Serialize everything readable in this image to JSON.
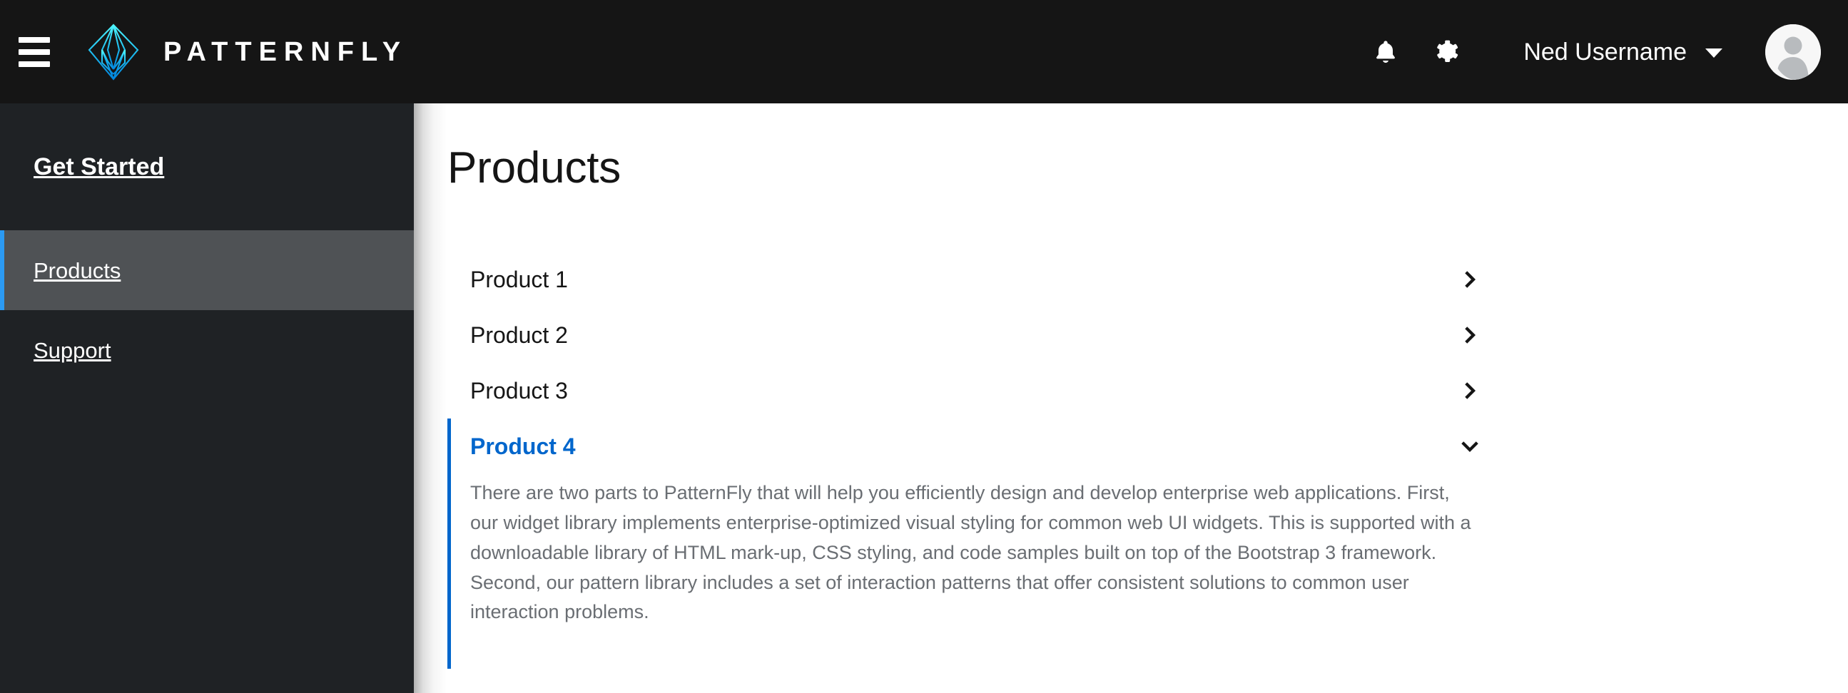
{
  "masthead": {
    "toggle_label": "Global navigation",
    "brand_name": "PATTERNFLY",
    "notifications_label": "Notifications",
    "settings_label": "Settings",
    "user_name": "Ned Username",
    "avatar_label": "Avatar"
  },
  "sidebar": {
    "items": [
      {
        "label": "Get Started",
        "type": "heading",
        "current": false
      },
      {
        "label": "Products",
        "type": "item",
        "current": true
      },
      {
        "label": "Support",
        "type": "item",
        "current": false
      }
    ]
  },
  "main": {
    "page_title": "Products",
    "accordion": [
      {
        "label": "Product 1",
        "expanded": false,
        "chevron": "chevron-right-icon",
        "body": ""
      },
      {
        "label": "Product 2",
        "expanded": false,
        "chevron": "chevron-right-icon",
        "body": ""
      },
      {
        "label": "Product 3",
        "expanded": false,
        "chevron": "chevron-right-icon",
        "body": ""
      },
      {
        "label": "Product 4",
        "expanded": true,
        "chevron": "chevron-down-icon",
        "body": "There are two parts to PatternFly that will help you efficiently design and develop enterprise web applications. First, our widget library implements enterprise-optimized visual styling for common web UI widgets. This is supported with a downloadable library of HTML mark-up, CSS styling, and code samples built on top of the Bootstrap 3 framework. Second, our pattern library includes a set of interaction patterns that offer consistent solutions to common user interaction problems."
      }
    ]
  },
  "colors": {
    "masthead_bg": "#151515",
    "sidebar_bg": "#1f2225",
    "sidebar_current_bg": "#4f5255",
    "sidebar_current_accent": "#2b9af3",
    "accent_blue": "#0066cc",
    "text_dark": "#151515",
    "text_muted": "#6a6e73",
    "logo_cyan": "#2ee6f0",
    "logo_blue": "#0091e6"
  }
}
